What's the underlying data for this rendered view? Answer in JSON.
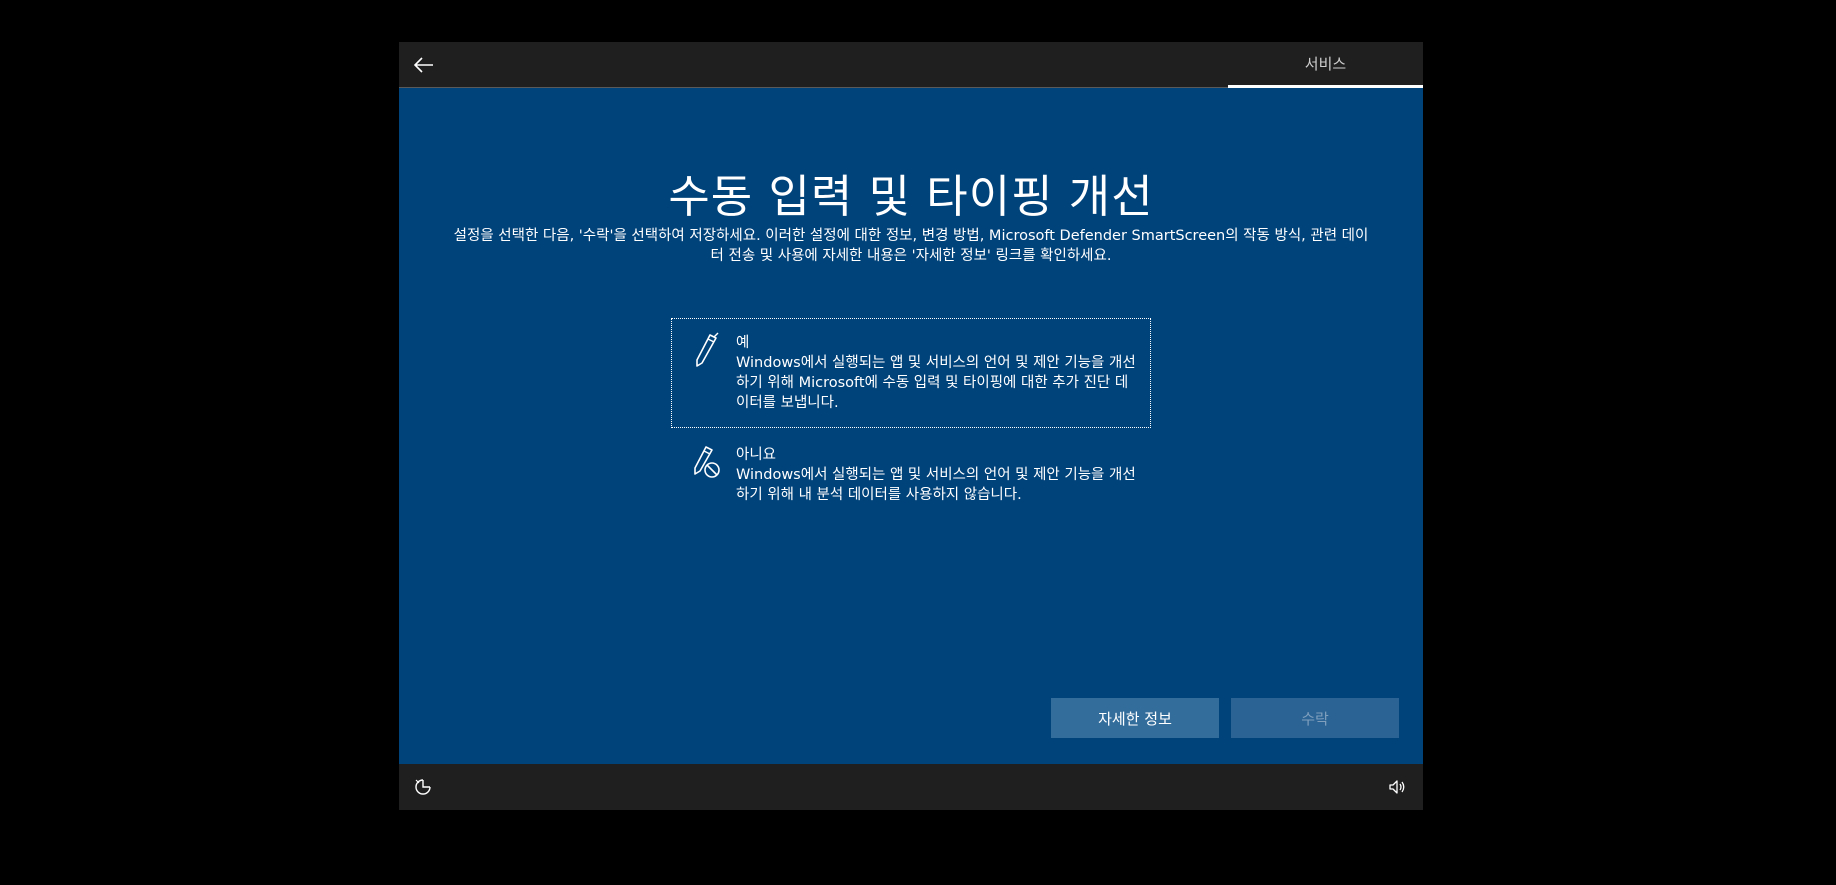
{
  "header": {
    "back_icon": "arrow-left-icon",
    "section_tab": "서비스"
  },
  "main": {
    "title": "수동 입력 및 타이핑 개선",
    "description": "설정을 선택한 다음, '수락'을 선택하여 저장하세요. 이러한 설정에 대한 정보, 변경 방법, Microsoft Defender SmartScreen의 작동 방식, 관련 데이터 전송 및 사용에 자세한 내용은 '자세한 정보' 링크를 확인하세요.",
    "options": [
      {
        "icon": "pen-icon",
        "title": "예",
        "description": "Windows에서 실행되는 앱 및 서비스의 언어 및 제안 기능을 개선하기 위해 Microsoft에 수동 입력 및 타이핑에 대한 추가 진단 데이터를 보냅니다.",
        "selected": true
      },
      {
        "icon": "pen-disabled-icon",
        "title": "아니요",
        "description": "Windows에서 실행되는 앱 및 서비스의 언어 및 제안 기능을 개선하기 위해 내 분석 데이터를 사용하지 않습니다.",
        "selected": false
      }
    ]
  },
  "buttons": {
    "learn_more": "자세한 정보",
    "accept": "수락"
  },
  "footer": {
    "left_icon": "ease-of-access-icon",
    "right_icon": "volume-icon"
  },
  "colors": {
    "background": "#00427a",
    "bar": "#1f1f1f",
    "button": "#336d9c",
    "button_disabled_text": "#7f9fbd"
  }
}
